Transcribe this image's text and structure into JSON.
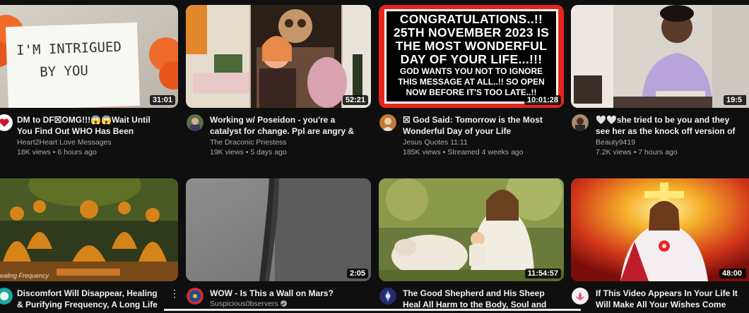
{
  "videos": [
    {
      "title": "DM to DF☒OMG!!!😱😱Wait Until You Find Out WHO Has Been Watching YOU...",
      "channel": "Heart2Heart Love Messages",
      "meta": "18K views • 6 hours ago",
      "duration": "31:01",
      "thumb_text": [
        "I'M INTRIGUED",
        "BY YOU"
      ],
      "avatar_icon": "heart-avatar"
    },
    {
      "title": "Working w/ Poseidon - you're a catalyst for change. Ppl are angry & afraid - stay...",
      "channel": "The Draconic Priestess",
      "meta": "19K views • 5 days ago",
      "duration": "52:21",
      "avatar_icon": "priestess-avatar"
    },
    {
      "title": "☒ God Said: Tomorrow is the Most Wonderful Day of your Life Because.....",
      "channel": "Jesus Quotes 11:11",
      "meta": "185K views • Streamed 4 weeks ago",
      "duration": "10:01:28",
      "thumb_text": [
        "CONGRATULATIONS..!!",
        "25TH NOVEMBER 2023 IS",
        "THE MOST WONDERFUL",
        "DAY OF YOUR LIFE...!!!",
        "GOD WANTS YOU NOT TO IGNORE",
        "THIS MESSAGE AT ALL..!! SO OPEN",
        "NOW BEFORE IT'S TOO LATE..!!"
      ],
      "avatar_icon": "jesus-avatar"
    },
    {
      "title": "🤍🤍she tried to be you and they see her as the knock off version of you.she...",
      "channel": "Beauty9419",
      "meta": "7.2K views • 7 hours ago",
      "duration": "19:5",
      "avatar_icon": "beauty-avatar"
    },
    {
      "title": "Discomfort Will Disappear, Healing & Purifying Frequency, A Long Life Of Well...",
      "channel": "",
      "meta": "",
      "duration": "",
      "thumb_caption": "ealing Frequency",
      "avatar_icon": "healing-avatar"
    },
    {
      "title": "WOW - Is This a Wall on Mars?",
      "channel": "Suspicious0bservers",
      "meta": "",
      "duration": "2:05",
      "avatar_icon": "observers-avatar"
    },
    {
      "title": "The Good Shepherd and His Sheep Heal All Harm to the Body, Soul and Spirit...",
      "channel": "",
      "meta": "",
      "duration": "11:54:57",
      "avatar_icon": "shepherd-avatar"
    },
    {
      "title": "If This Video Appears In Your Life It Will Make All Your Wishes Come True, Jesus...",
      "channel": "",
      "meta": "",
      "duration": "48:00",
      "avatar_icon": "lotus-avatar"
    }
  ],
  "menu_icon": "more-vert-icon"
}
